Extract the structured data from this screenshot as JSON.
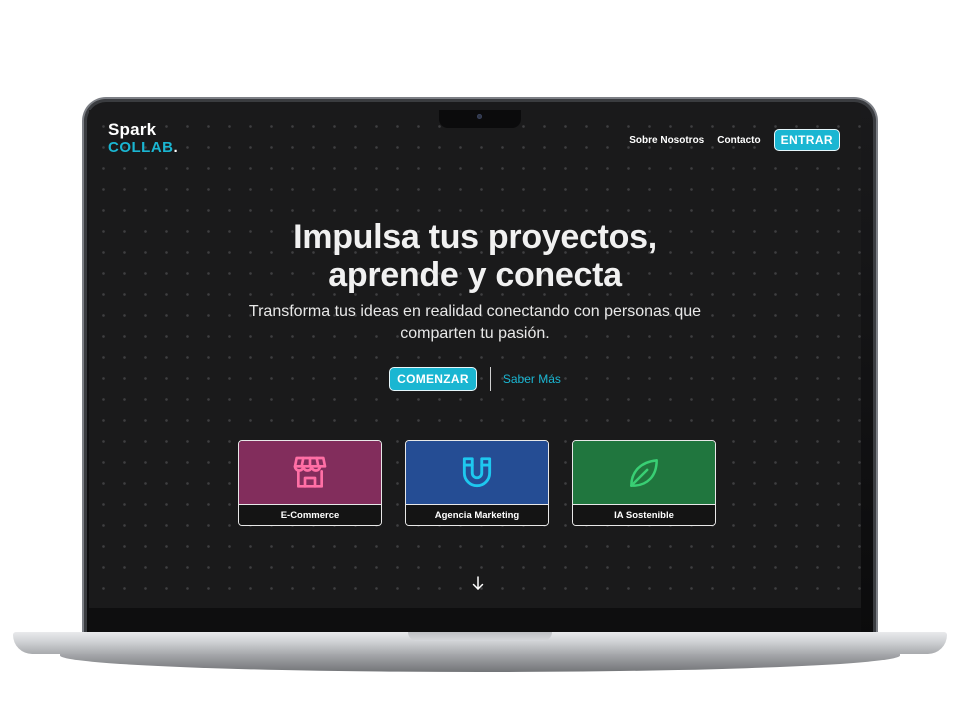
{
  "brand": {
    "line1": "Spark",
    "line2": "COLLAB",
    "dot": ".",
    "accent": "#1ab6d2"
  },
  "nav": {
    "about": "Sobre Nosotros",
    "contact": "Contacto",
    "login": "ENTRAR"
  },
  "hero": {
    "title_line1": "Impulsa tus proyectos,",
    "title_line2": "aprende y conecta",
    "subtitle": "Transforma tus ideas en realidad conectando con personas que comparten tu pasión.",
    "cta_primary": "COMENZAR",
    "cta_secondary": "Saber Más"
  },
  "cards": [
    {
      "label": "E-Commerce",
      "icon": "storefront-icon",
      "bg": "#822d5c",
      "icon_color": "#ff6fa5"
    },
    {
      "label": "Agencia Marketing",
      "icon": "magnet-icon",
      "bg": "#254d94",
      "icon_color": "#1ec8ef"
    },
    {
      "label": "IA Sostenible",
      "icon": "leaf-icon",
      "bg": "#20763e",
      "icon_color": "#39cf74"
    }
  ],
  "scroll": {
    "icon": "arrow-down-icon"
  }
}
